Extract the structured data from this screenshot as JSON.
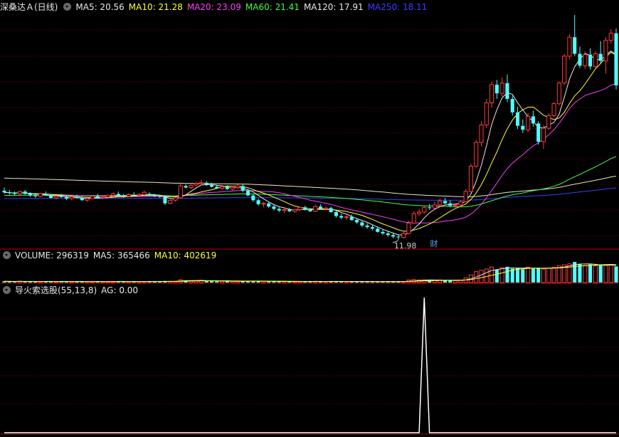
{
  "panels": {
    "price": {
      "title": "深桑达Ａ(日线)",
      "indicators": [
        {
          "label": "MA5: 20.56",
          "color": "#e8e8e8"
        },
        {
          "label": "MA10: 21.28",
          "color": "#ffff3c"
        },
        {
          "label": "MA20: 23.09",
          "color": "#ff3cff"
        },
        {
          "label": "MA60: 21.41",
          "color": "#3cff3c"
        },
        {
          "label": "MA120: 17.91",
          "color": "#e8e8e8"
        },
        {
          "label": "MA250: 18.11",
          "color": "#3c3cff"
        }
      ],
      "low_label": "11.98",
      "event_badge": "财"
    },
    "volume": {
      "indicators": [
        {
          "label": "VOLUME: 296319",
          "color": "#e8e8e8"
        },
        {
          "label": "MA5: 365466",
          "color": "#e8e8e8"
        },
        {
          "label": "MA10: 402619",
          "color": "#ffff3c"
        }
      ]
    },
    "signal": {
      "indicators": [
        {
          "label": "导火索选股(55,13,8)",
          "color": "#e8e8e8"
        },
        {
          "label": "AG: 0.00",
          "color": "#e8e8e8"
        }
      ]
    }
  },
  "colors": {
    "up": "#ff3c3c",
    "down": "#54fcfc",
    "grid": "#8b0000",
    "separator": "#b00000",
    "ma5": "#e8e8e8",
    "ma10": "#ffff3c",
    "ma20": "#ff3cff",
    "ma60": "#3cff3c",
    "ma120": "#e8e8c0",
    "ma250": "#3c3cff",
    "signal": "#ffffff"
  },
  "chart_data": {
    "type": "candlestick",
    "title": "深桑达Ａ(日线)",
    "ylim": [
      11.0,
      40.5
    ],
    "candles_ohlc": [
      [
        18.2,
        18.6,
        17.8,
        18.0
      ],
      [
        18.0,
        18.3,
        17.7,
        17.9
      ],
      [
        17.9,
        18.1,
        17.6,
        17.8
      ],
      [
        17.8,
        18.2,
        17.6,
        18.1
      ],
      [
        18.1,
        18.3,
        17.7,
        17.8
      ],
      [
        17.8,
        18.0,
        17.4,
        17.6
      ],
      [
        17.6,
        17.9,
        17.3,
        17.5
      ],
      [
        17.5,
        17.9,
        17.4,
        17.8
      ],
      [
        17.8,
        18.1,
        17.5,
        17.6
      ],
      [
        17.6,
        17.8,
        17.2,
        17.3
      ],
      [
        17.3,
        17.6,
        17.1,
        17.5
      ],
      [
        17.5,
        17.8,
        17.3,
        17.4
      ],
      [
        17.4,
        17.6,
        17.0,
        17.2
      ],
      [
        17.2,
        17.5,
        17.0,
        17.4
      ],
      [
        17.4,
        17.7,
        17.2,
        17.3
      ],
      [
        17.3,
        17.5,
        16.9,
        17.0
      ],
      [
        17.0,
        17.3,
        16.8,
        17.2
      ],
      [
        17.2,
        17.6,
        17.1,
        17.5
      ],
      [
        17.5,
        17.8,
        17.2,
        17.3
      ],
      [
        17.3,
        17.6,
        17.1,
        17.4
      ],
      [
        17.4,
        17.7,
        17.2,
        17.6
      ],
      [
        17.6,
        18.0,
        17.4,
        17.8
      ],
      [
        17.8,
        18.1,
        17.5,
        17.6
      ],
      [
        17.6,
        17.8,
        17.3,
        17.5
      ],
      [
        17.5,
        17.9,
        17.4,
        17.7
      ],
      [
        17.7,
        18.0,
        17.5,
        17.6
      ],
      [
        17.6,
        17.9,
        17.4,
        17.7
      ],
      [
        17.7,
        18.2,
        17.6,
        18.0
      ],
      [
        17.8,
        18.0,
        17.5,
        17.6
      ],
      [
        17.6,
        17.8,
        17.4,
        17.5
      ],
      [
        17.5,
        17.7,
        17.3,
        17.4
      ],
      [
        17.4,
        17.5,
        16.4,
        16.6
      ],
      [
        16.6,
        17.1,
        16.5,
        17.0
      ],
      [
        17.0,
        17.4,
        16.8,
        17.3
      ],
      [
        17.3,
        19.1,
        17.2,
        18.8
      ],
      [
        18.8,
        19.0,
        18.5,
        18.6
      ],
      [
        18.6,
        19.0,
        18.4,
        18.9
      ],
      [
        18.9,
        19.3,
        18.7,
        19.1
      ],
      [
        19.1,
        19.6,
        18.9,
        19.2
      ],
      [
        19.2,
        19.4,
        18.8,
        19.0
      ],
      [
        19.0,
        19.2,
        18.6,
        18.7
      ],
      [
        18.7,
        18.9,
        18.4,
        18.5
      ],
      [
        18.5,
        18.8,
        18.3,
        18.7
      ],
      [
        18.7,
        18.9,
        18.3,
        18.4
      ],
      [
        18.4,
        18.8,
        18.2,
        18.6
      ],
      [
        18.6,
        19.0,
        18.4,
        18.8
      ],
      [
        18.8,
        19.0,
        18.0,
        18.2
      ],
      [
        18.2,
        18.4,
        17.5,
        17.6
      ],
      [
        17.6,
        17.8,
        16.8,
        17.0
      ],
      [
        17.0,
        17.2,
        16.3,
        16.5
      ],
      [
        16.5,
        16.8,
        16.1,
        16.6
      ],
      [
        16.6,
        16.8,
        16.0,
        16.2
      ],
      [
        16.2,
        16.4,
        15.7,
        15.9
      ],
      [
        15.9,
        16.1,
        15.5,
        15.7
      ],
      [
        15.7,
        15.9,
        15.4,
        15.8
      ],
      [
        15.8,
        16.0,
        15.5,
        15.6
      ],
      [
        15.6,
        15.9,
        15.4,
        15.8
      ],
      [
        15.8,
        16.2,
        15.6,
        16.1
      ],
      [
        16.1,
        16.3,
        15.7,
        15.8
      ],
      [
        15.8,
        16.0,
        15.5,
        15.6
      ],
      [
        15.6,
        16.4,
        15.5,
        16.2
      ],
      [
        16.2,
        16.5,
        15.8,
        15.9
      ],
      [
        15.9,
        16.2,
        15.7,
        16.0
      ],
      [
        16.0,
        16.2,
        15.4,
        15.5
      ],
      [
        15.5,
        15.7,
        14.8,
        15.0
      ],
      [
        15.0,
        15.3,
        14.6,
        14.8
      ],
      [
        14.8,
        15.1,
        14.5,
        14.9
      ],
      [
        14.9,
        15.2,
        14.4,
        14.5
      ],
      [
        14.5,
        14.7,
        14.0,
        14.2
      ],
      [
        14.2,
        14.4,
        13.6,
        13.8
      ],
      [
        13.8,
        14.1,
        13.4,
        13.6
      ],
      [
        13.6,
        13.9,
        13.2,
        13.4
      ],
      [
        13.4,
        13.7,
        12.9,
        13.0
      ],
      [
        13.0,
        13.3,
        12.6,
        12.8
      ],
      [
        12.8,
        13.1,
        12.4,
        12.6
      ],
      [
        12.6,
        12.9,
        12.2,
        12.4
      ],
      [
        12.4,
        12.7,
        11.98,
        12.3
      ],
      [
        12.3,
        13.0,
        12.2,
        12.8
      ],
      [
        12.8,
        14.4,
        12.7,
        14.1
      ],
      [
        14.1,
        15.6,
        14.0,
        15.3
      ],
      [
        15.3,
        15.9,
        15.0,
        15.5
      ],
      [
        15.5,
        16.3,
        15.3,
        16.1
      ],
      [
        16.1,
        16.5,
        15.8,
        16.0
      ],
      [
        16.0,
        16.8,
        15.9,
        16.4
      ],
      [
        16.4,
        17.2,
        16.2,
        16.9
      ],
      [
        16.9,
        17.3,
        16.5,
        16.6
      ],
      [
        16.6,
        17.0,
        16.1,
        16.3
      ],
      [
        16.3,
        16.6,
        15.9,
        16.4
      ],
      [
        16.4,
        17.0,
        16.2,
        16.8
      ],
      [
        16.8,
        18.4,
        16.7,
        18.1
      ],
      [
        18.1,
        21.6,
        18.0,
        21.3
      ],
      [
        21.3,
        24.6,
        21.1,
        24.3
      ],
      [
        24.3,
        27.0,
        23.8,
        26.5
      ],
      [
        26.5,
        29.8,
        26.1,
        29.3
      ],
      [
        29.3,
        32.0,
        28.7,
        31.6
      ],
      [
        31.6,
        32.2,
        29.8,
        30.5
      ],
      [
        30.5,
        32.5,
        30.1,
        31.8
      ],
      [
        31.8,
        32.9,
        29.4,
        29.8
      ],
      [
        29.8,
        30.2,
        27.7,
        28.1
      ],
      [
        28.1,
        28.8,
        26.0,
        26.4
      ],
      [
        26.4,
        27.2,
        25.5,
        25.9
      ],
      [
        25.9,
        28.0,
        25.6,
        27.6
      ],
      [
        27.6,
        28.3,
        26.3,
        26.7
      ],
      [
        26.7,
        27.0,
        24.0,
        24.4
      ],
      [
        24.4,
        26.5,
        23.5,
        26.1
      ],
      [
        26.1,
        28.0,
        25.9,
        27.7
      ],
      [
        27.7,
        29.4,
        27.5,
        29.2
      ],
      [
        29.2,
        32.0,
        29.0,
        31.8
      ],
      [
        31.8,
        35.5,
        31.6,
        35.2
      ],
      [
        35.2,
        38.0,
        34.8,
        37.6
      ],
      [
        37.6,
        40.4,
        35.2,
        35.5
      ],
      [
        35.5,
        36.4,
        33.7,
        34.0
      ],
      [
        34.0,
        35.8,
        33.6,
        35.4
      ],
      [
        35.4,
        36.2,
        33.5,
        33.9
      ],
      [
        33.9,
        35.8,
        33.6,
        35.5
      ],
      [
        35.5,
        37.1,
        34.3,
        34.6
      ],
      [
        34.6,
        37.6,
        33.0,
        37.2
      ],
      [
        37.2,
        38.6,
        36.8,
        38.1
      ],
      [
        38.1,
        38.7,
        31.0,
        31.5
      ]
    ],
    "volume": [
      0.4,
      0.3,
      0.3,
      0.4,
      0.3,
      0.3,
      0.3,
      0.3,
      0.3,
      0.3,
      0.3,
      0.3,
      0.3,
      0.3,
      0.3,
      0.3,
      0.3,
      0.3,
      0.3,
      0.3,
      0.3,
      0.3,
      0.3,
      0.3,
      0.3,
      0.3,
      0.3,
      0.3,
      0.3,
      0.3,
      0.3,
      0.5,
      0.4,
      0.4,
      0.9,
      0.7,
      0.6,
      0.6,
      0.6,
      0.5,
      0.5,
      0.4,
      0.4,
      0.4,
      0.4,
      0.4,
      0.5,
      0.5,
      0.5,
      0.4,
      0.4,
      0.4,
      0.4,
      0.3,
      0.3,
      0.3,
      0.3,
      0.3,
      0.3,
      0.3,
      0.4,
      0.4,
      0.3,
      0.3,
      0.4,
      0.3,
      0.3,
      0.3,
      0.3,
      0.3,
      0.3,
      0.3,
      0.3,
      0.3,
      0.3,
      0.3,
      0.3,
      0.3,
      0.8,
      1.0,
      0.8,
      0.8,
      0.7,
      0.7,
      0.8,
      0.7,
      0.6,
      0.6,
      0.7,
      1.5,
      2.4,
      3.4,
      3.8,
      4.2,
      4.8,
      4.0,
      4.6,
      4.9,
      4.3,
      4.6,
      4.1,
      4.8,
      4.3,
      4.5,
      4.2,
      4.5,
      4.8,
      5.2,
      5.5,
      5.8,
      6.4,
      5.8,
      5.3,
      5.6,
      5.2,
      5.5,
      5.3,
      5.6,
      5.0
    ],
    "signal": {
      "peak_index": 81,
      "peak_value": 1.0,
      "rest_value": 0.0
    }
  }
}
